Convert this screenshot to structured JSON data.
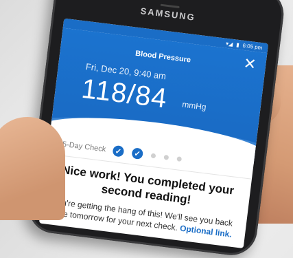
{
  "phone": {
    "brand": "SAMSUNG"
  },
  "statusbar": {
    "time": "6:05 pm"
  },
  "header": {
    "title": "Blood Pressure",
    "datetime": "Fri, Dec 20, 9:40 am",
    "reading": "118/84",
    "unit": "mmHg"
  },
  "check": {
    "label": "5-Day Check",
    "completed": 2,
    "total": 5
  },
  "message": {
    "title": "Nice work! You completed your second reading!",
    "body": "You're getting the hang of this! We'll see you back here tomorrow for your next check.",
    "link": "Optional link."
  },
  "colors": {
    "accent": "#1a6dc6"
  }
}
